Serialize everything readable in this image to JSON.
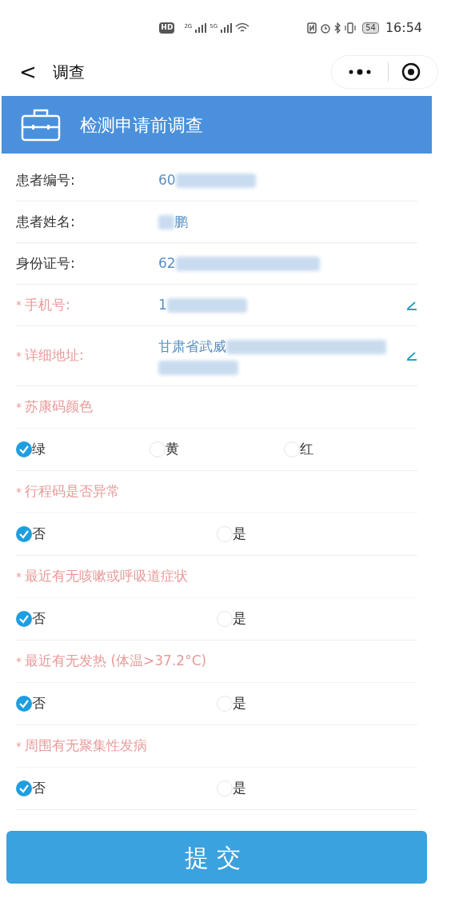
{
  "status_bar": {
    "hd": "HD",
    "signal_1": "2G",
    "signal_2": "5G",
    "battery": "54",
    "time": "16:54"
  },
  "nav": {
    "back": "<",
    "title": "调查"
  },
  "header": {
    "title": "检测申请前调查"
  },
  "fields": [
    {
      "label": "患者编号:",
      "value": "60",
      "editable": false
    },
    {
      "label": "患者姓名:",
      "value": "鹏",
      "editable": false
    },
    {
      "label": "身份证号:",
      "value": "62",
      "editable": false
    },
    {
      "asterisk": "*",
      "label": "手机号:",
      "value": "1",
      "editable": true
    },
    {
      "asterisk": "*",
      "label": "详细地址:",
      "value": "甘肃省武威",
      "editable": true
    }
  ],
  "questions": [
    {
      "asterisk": "*",
      "label": "苏康码颜色",
      "options": [
        {
          "label": "绿",
          "selected": true
        },
        {
          "label": "黄",
          "selected": false
        },
        {
          "label": "红",
          "selected": false
        }
      ]
    },
    {
      "asterisk": "*",
      "label": "行程码是否异常",
      "options": [
        {
          "label": "否",
          "selected": true
        },
        {
          "label": "是",
          "selected": false
        }
      ]
    },
    {
      "asterisk": "*",
      "label": "最近有无咳嗽或呼吸道症状",
      "options": [
        {
          "label": "否",
          "selected": true
        },
        {
          "label": "是",
          "selected": false
        }
      ]
    },
    {
      "asterisk": "*",
      "label": "最近有无发热 (体温>37.2°C)",
      "options": [
        {
          "label": "否",
          "selected": true
        },
        {
          "label": "是",
          "selected": false
        }
      ]
    },
    {
      "asterisk": "*",
      "label": "周围有无聚集性发病",
      "options": [
        {
          "label": "否",
          "selected": true
        },
        {
          "label": "是",
          "selected": false
        }
      ]
    }
  ],
  "submit": "提交"
}
